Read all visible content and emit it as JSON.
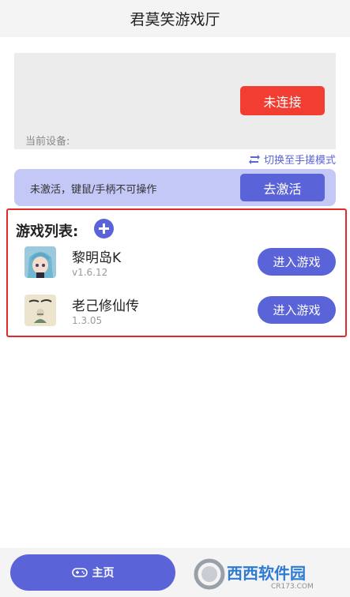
{
  "header": {
    "title": "君莫笑游戏厅"
  },
  "device": {
    "connect_label": "未连接",
    "current_device_label": "当前设备:"
  },
  "switch_mode": {
    "icon": "swap-icon",
    "label": "切换至手搓模式"
  },
  "activation": {
    "status_text": "未激活，键鼠/手柄不可操作",
    "activate_label": "去激活"
  },
  "games": {
    "title": "游戏列表:",
    "add_icon": "plus-circle-icon",
    "items": [
      {
        "name": "黎明岛K",
        "version": "v1.6.12",
        "action": "进入游戏"
      },
      {
        "name": "老己修仙传",
        "version": "1.3.05",
        "action": "进入游戏"
      }
    ]
  },
  "bottom_nav": {
    "home_label": "主页",
    "home_icon": "gamepad-icon",
    "watermark": {
      "brand": "西西软件园",
      "url": "CR173.COM"
    }
  },
  "colors": {
    "accent": "#5a63d8",
    "danger": "#f23d32",
    "highlight_border": "#e02a2a",
    "activation_bg": "#c4c8f7"
  }
}
